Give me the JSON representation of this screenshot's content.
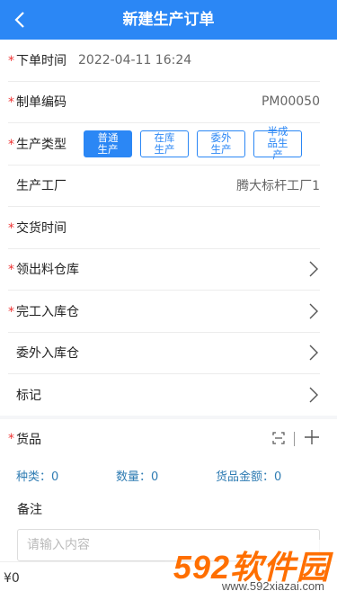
{
  "header": {
    "title": "新建生产订单"
  },
  "form": {
    "order_time": {
      "label": "下单时间",
      "value": "2022-04-11 16:24"
    },
    "order_code": {
      "label": "制单编码",
      "value": "PM00050"
    },
    "production_type": {
      "label": "生产类型",
      "options": [
        "普通生产",
        "在库生产",
        "委外生产",
        "半成品生产"
      ],
      "selected": "普通生产"
    },
    "factory": {
      "label": "生产工厂",
      "value": "腾大标杆工厂1"
    },
    "delivery_time": {
      "label": "交货时间"
    },
    "material_warehouse": {
      "label": "领出料仓库"
    },
    "finish_warehouse": {
      "label": "完工入库仓"
    },
    "outsource_warehouse": {
      "label": "委外入库仓"
    },
    "mark": {
      "label": "标记"
    }
  },
  "goods": {
    "label": "货品",
    "stats": {
      "kinds": "种类：0",
      "quantity": "数量：0",
      "amount": "货品金额：0"
    }
  },
  "remark": {
    "label": "备注",
    "placeholder": "请输入内容"
  },
  "footer": {
    "total": "¥0"
  },
  "watermark": {
    "logo": "592软件园",
    "url": "www.592xiazai.com"
  },
  "colors": {
    "primary": "#2b87f5",
    "required": "#e33333",
    "stats": "#2f7cb3"
  }
}
